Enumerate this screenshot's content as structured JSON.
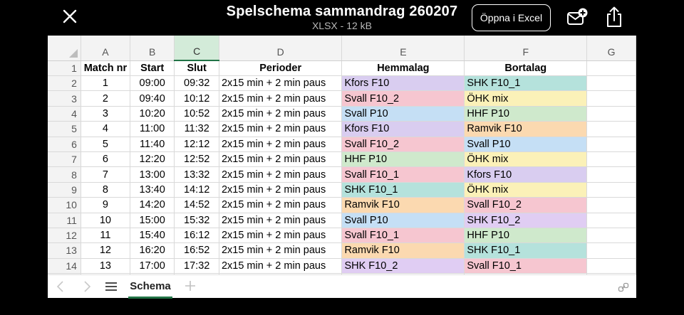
{
  "header": {
    "title": "Spelschema sammandrag 260207",
    "subtitle": "XLSX - 12 kB",
    "open_button": "Öppna i Excel"
  },
  "columns": [
    "A",
    "B",
    "C",
    "D",
    "E",
    "F",
    "G"
  ],
  "selected_column": "C",
  "row_numbers": [
    "1",
    "2",
    "3",
    "4",
    "5",
    "6",
    "7",
    "8",
    "9",
    "10",
    "11",
    "12",
    "13",
    "14"
  ],
  "table": {
    "headers": [
      "Match nr",
      "Start",
      "Slut",
      "Perioder",
      "Hemmalag",
      "Bortalag"
    ],
    "rows": [
      [
        "1",
        "09:00",
        "09:32",
        "2x15 min + 2 min paus",
        "Kfors F10",
        "SHK F10_1"
      ],
      [
        "2",
        "09:40",
        "10:12",
        "2x15 min + 2 min paus",
        "Svall F10_2",
        "ÖHK mix"
      ],
      [
        "3",
        "10:20",
        "10:52",
        "2x15 min + 2 min paus",
        "Svall P10",
        "HHF P10"
      ],
      [
        "4",
        "11:00",
        "11:32",
        "2x15 min + 2 min paus",
        "Kfors F10",
        "Ramvik F10"
      ],
      [
        "5",
        "11:40",
        "12:12",
        "2x15 min + 2 min paus",
        "Svall F10_2",
        "Svall P10"
      ],
      [
        "6",
        "12:20",
        "12:52",
        "2x15 min + 2 min paus",
        "HHF P10",
        "ÖHK mix"
      ],
      [
        "7",
        "13:00",
        "13:32",
        "2x15 min + 2 min paus",
        "Svall F10_1",
        "Kfors F10"
      ],
      [
        "8",
        "13:40",
        "14:12",
        "2x15 min + 2 min paus",
        "SHK F10_1",
        "ÖHK mix"
      ],
      [
        "9",
        "14:20",
        "14:52",
        "2x15 min + 2 min paus",
        "Ramvik F10",
        "Svall F10_2"
      ],
      [
        "10",
        "15:00",
        "15:32",
        "2x15 min + 2 min paus",
        "Svall P10",
        "SHK F10_2"
      ],
      [
        "11",
        "15:40",
        "16:12",
        "2x15 min + 2 min paus",
        "Svall F10_1",
        "HHF P10"
      ],
      [
        "12",
        "16:20",
        "16:52",
        "2x15 min + 2 min paus",
        "Ramvik F10",
        "SHK F10_1"
      ],
      [
        "13",
        "17:00",
        "17:32",
        "2x15 min + 2 min paus",
        "SHK F10_2",
        "Svall F10_1"
      ]
    ]
  },
  "team_colors": {
    "Kfors F10": "#d9cdf0",
    "SHK F10_1": "#b5e2dc",
    "Svall F10_2": "#f6c6d0",
    "ÖHK mix": "#fbf1b8",
    "Svall P10": "#c5dff5",
    "HHF P10": "#cfe9cc",
    "Ramvik F10": "#fbd9b0",
    "Svall F10_1": "#f6c6d0",
    "SHK F10_2": "#e0cdf3"
  },
  "tabs": {
    "active": "Schema"
  },
  "icons": {
    "close": "close-icon",
    "mail": "mail-add-icon",
    "share": "share-icon",
    "prev": "chevron-left-icon",
    "next": "chevron-right-icon",
    "menu": "menu-icon",
    "add": "plus-icon",
    "corner": "link-icon"
  },
  "accent_color": "#217346"
}
